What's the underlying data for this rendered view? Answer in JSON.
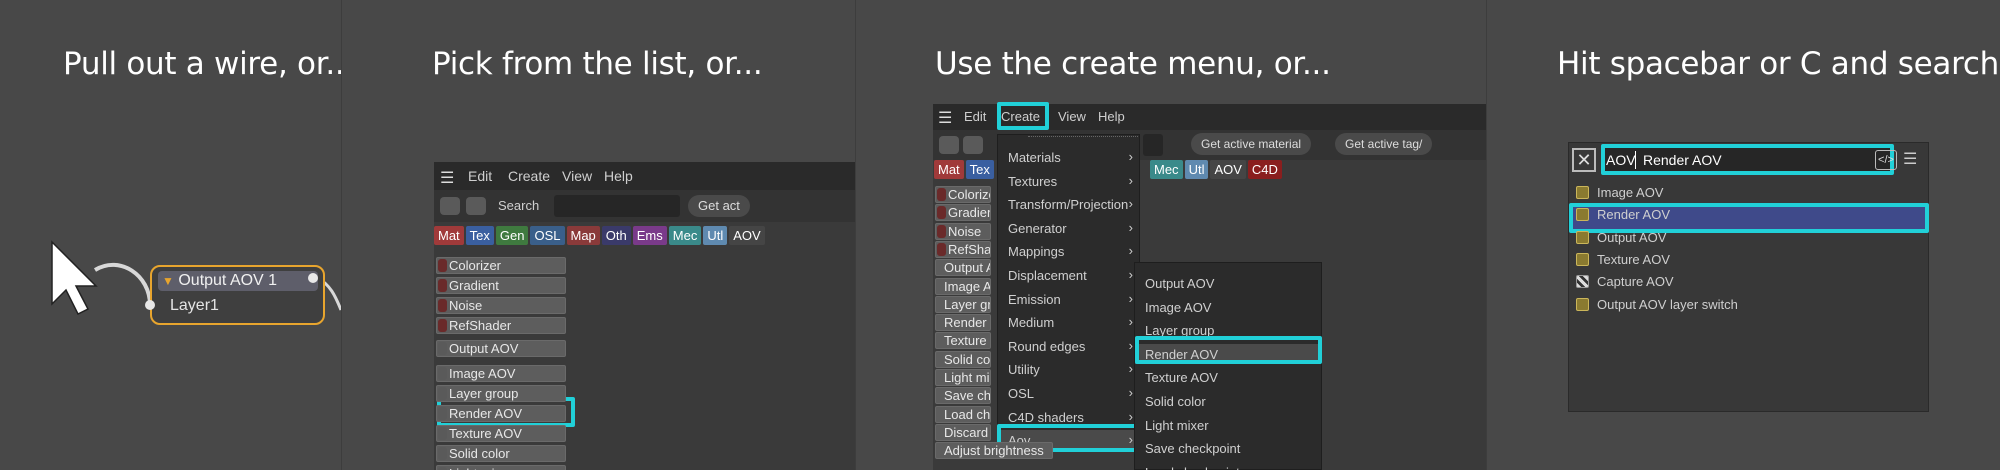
{
  "panel1": {
    "heading": "Pull out a wire, or...",
    "node": {
      "title": "Output AOV 1",
      "input": "Layer1",
      "title_icon": "triangle-down-icon"
    }
  },
  "panel2": {
    "heading": "Pick from the list, or...",
    "menubar": [
      "Edit",
      "Create",
      "View",
      "Help"
    ],
    "search_label": "Search",
    "get_button": "Get act",
    "tags": [
      {
        "label": "Mat",
        "color": "#a03a3a"
      },
      {
        "label": "Tex",
        "color": "#3a5fa0"
      },
      {
        "label": "Gen",
        "color": "#3f7a3f"
      },
      {
        "label": "OSL",
        "color": "#3a5f8a"
      },
      {
        "label": "Map",
        "color": "#8a3a3a"
      },
      {
        "label": "Oth",
        "color": "#3a3a6a"
      },
      {
        "label": "Ems",
        "color": "#7a3a8a"
      },
      {
        "label": "Mec",
        "color": "#3a8a8a"
      },
      {
        "label": "Utl",
        "color": "#5f8ab0"
      },
      {
        "label": "AOV",
        "color": "#454545"
      }
    ],
    "list": [
      {
        "label": "Colorizer",
        "dot": "#6a2a2a"
      },
      {
        "label": "Gradient",
        "dot": "#6a2a2a"
      },
      {
        "label": "Noise",
        "dot": "#6a2a2a"
      },
      {
        "label": "RefShader",
        "dot": "#6a2a2a"
      },
      {
        "label": "Output AOV",
        "dot": "#5a5a5a"
      },
      {
        "label": "Image AOV",
        "dot": "#5a5a5a"
      },
      {
        "label": "Layer group",
        "dot": "#5a5a5a"
      },
      {
        "label": "Render AOV",
        "dot": "#5a5a5a"
      },
      {
        "label": "Texture AOV",
        "dot": "#5a5a5a"
      },
      {
        "label": "Solid color",
        "dot": "#5a5a5a"
      },
      {
        "label": "Light mixer",
        "dot": "#5a5a5a"
      }
    ]
  },
  "panel3": {
    "heading": "Use the create menu, or...",
    "menubar": [
      "Edit",
      "Create",
      "View",
      "Help"
    ],
    "get_active_material": "Get active material",
    "get_active_tag": "Get active tag/",
    "tags": [
      {
        "label": "Mat",
        "color": "#a03a3a"
      },
      {
        "label": "Tex",
        "color": "#3a5fa0"
      },
      {
        "label": "Mec",
        "color": "#3a8a8a"
      },
      {
        "label": "Utl",
        "color": "#5f8ab0"
      },
      {
        "label": "AOV",
        "color": "#454545"
      },
      {
        "label": "C4D",
        "color": "#8a1e1e"
      }
    ],
    "left_list": [
      "Colorize",
      "Gradien",
      "Noise",
      "RefShad",
      "Output A",
      "Image A",
      "Layer gr",
      "Render",
      "Texture",
      "Solid co",
      "Light mi",
      "Save ch",
      "Load ch",
      "Discard",
      "Adjust brightness"
    ],
    "create_menu": [
      "Materials",
      "Textures",
      "Transform/Projection",
      "Generator",
      "Mappings",
      "Displacement",
      "Emission",
      "Medium",
      "Round edges",
      "Utility",
      "OSL",
      "C4D shaders",
      "Aov"
    ],
    "aov_submenu": [
      "Output AOV",
      "Image AOV",
      "Layer group",
      "Render AOV",
      "Texture AOV",
      "Solid color",
      "Light mixer",
      "Save checkpoint",
      "Load checkpoint"
    ]
  },
  "panel4": {
    "heading": "Hit spacebar or C and search",
    "search_value": "AOV",
    "search_suggestion": "Render AOV",
    "results": [
      "Image AOV",
      "Render AOV",
      "Output AOV",
      "Texture AOV",
      "Capture AOV",
      "Output AOV layer switch"
    ]
  }
}
